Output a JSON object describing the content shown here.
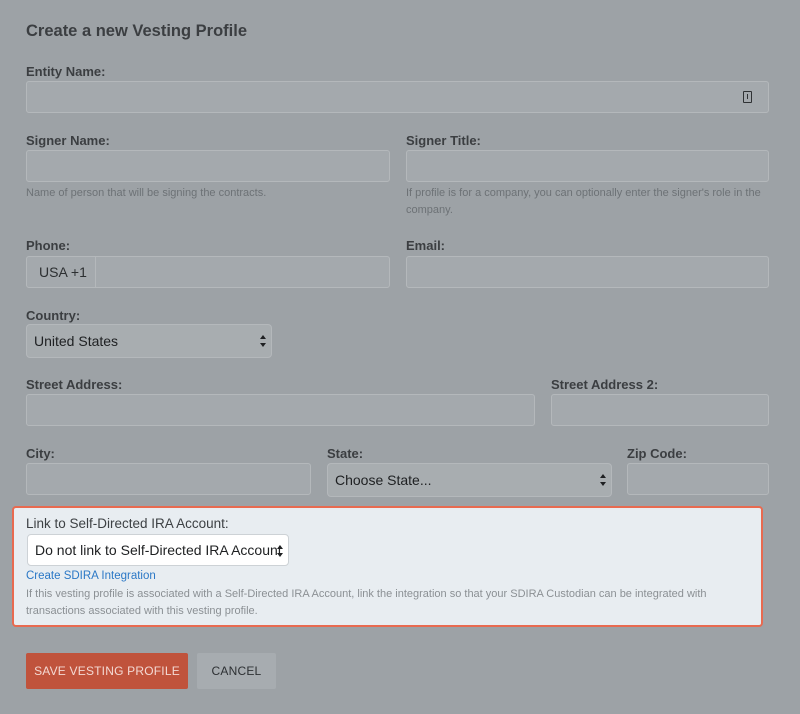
{
  "form": {
    "title": "Create a new Vesting Profile",
    "entity_name": {
      "label": "Entity Name:",
      "value": ""
    },
    "signer_name": {
      "label": "Signer Name:",
      "value": "",
      "help": "Name of person that will be signing the contracts."
    },
    "signer_title": {
      "label": "Signer Title:",
      "value": "",
      "help": "If profile is for a company, you can optionally enter the signer's role in the company."
    },
    "phone": {
      "label": "Phone:",
      "prefix": "USA +1",
      "value": ""
    },
    "email": {
      "label": "Email:",
      "value": ""
    },
    "country": {
      "label": "Country:",
      "selected": "United States"
    },
    "street_address": {
      "label": "Street Address:",
      "value": ""
    },
    "street_address_2": {
      "label": "Street Address 2:",
      "value": ""
    },
    "city": {
      "label": "City:",
      "value": ""
    },
    "state": {
      "label": "State:",
      "selected": "Choose State..."
    },
    "zip": {
      "label": "Zip Code:",
      "value": ""
    }
  },
  "sdira": {
    "label": "Link to Self-Directed IRA Account:",
    "selected": "Do not link to Self-Directed IRA Account",
    "link": "Create SDIRA Integration",
    "help": "If this vesting profile is associated with a Self-Directed IRA Account, link the integration so that your SDIRA Custodian can be integrated with transactions associated with this vesting profile."
  },
  "actions": {
    "save": "SAVE VESTING PROFILE",
    "cancel": "CANCEL"
  },
  "colors": {
    "overlay": "#9da2a6",
    "highlight_border": "#e86a50",
    "save_button": "#c0533c",
    "link": "#2b78c6"
  }
}
